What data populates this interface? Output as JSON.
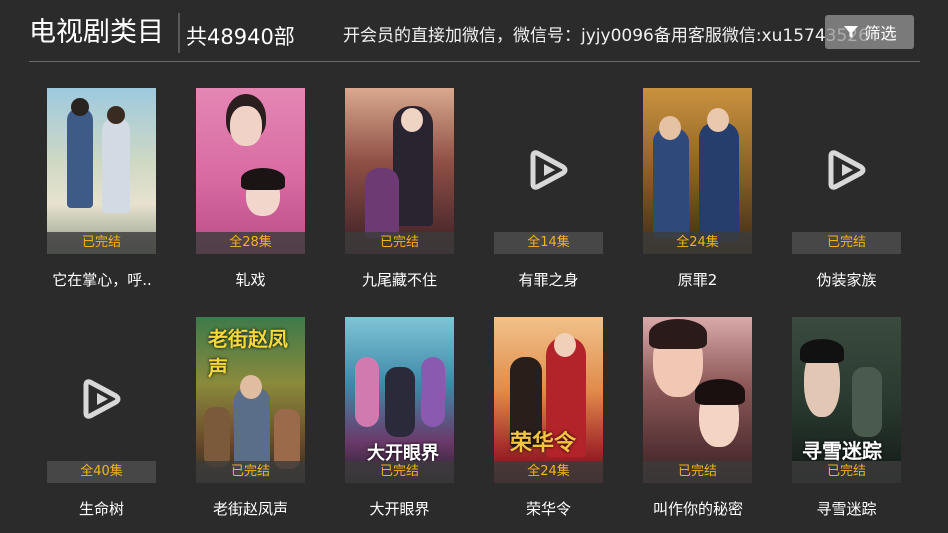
{
  "header": {
    "title": "电视剧类目",
    "count": "共48940部",
    "notice": "开会员的直接加微信，微信号：jyjy0096备用客服微信:xu15743526",
    "filter_label": "筛选"
  },
  "colors": {
    "background": "#2b2b2b",
    "badge_text": "#f2b318"
  },
  "shows": [
    {
      "name": "它在掌心，呼..",
      "badge": "已完结",
      "poster": "photo"
    },
    {
      "name": "轧戏",
      "badge": "全28集",
      "poster": "photo"
    },
    {
      "name": "九尾藏不住",
      "badge": "已完结",
      "poster": "photo"
    },
    {
      "name": "有罪之身",
      "badge": "全14集",
      "poster": "play-icon"
    },
    {
      "name": "原罪2",
      "badge": "全24集",
      "poster": "photo"
    },
    {
      "name": "伪装家族",
      "badge": "已完结",
      "poster": "play-icon"
    },
    {
      "name": "生命树",
      "badge": "全40集",
      "poster": "play-icon"
    },
    {
      "name": "老街赵凤声",
      "badge": "已完结",
      "poster": "photo",
      "poster_text": "老街赵凤声"
    },
    {
      "name": "大开眼界",
      "badge": "已完结",
      "poster": "photo",
      "poster_text": "大开眼界"
    },
    {
      "name": "荣华令",
      "badge": "全24集",
      "poster": "photo",
      "poster_text": "荣华令"
    },
    {
      "name": "叫作你的秘密",
      "badge": "已完结",
      "poster": "photo"
    },
    {
      "name": "寻雪迷踪",
      "badge": "已完结",
      "poster": "photo",
      "poster_text": "寻雪迷踪"
    }
  ]
}
